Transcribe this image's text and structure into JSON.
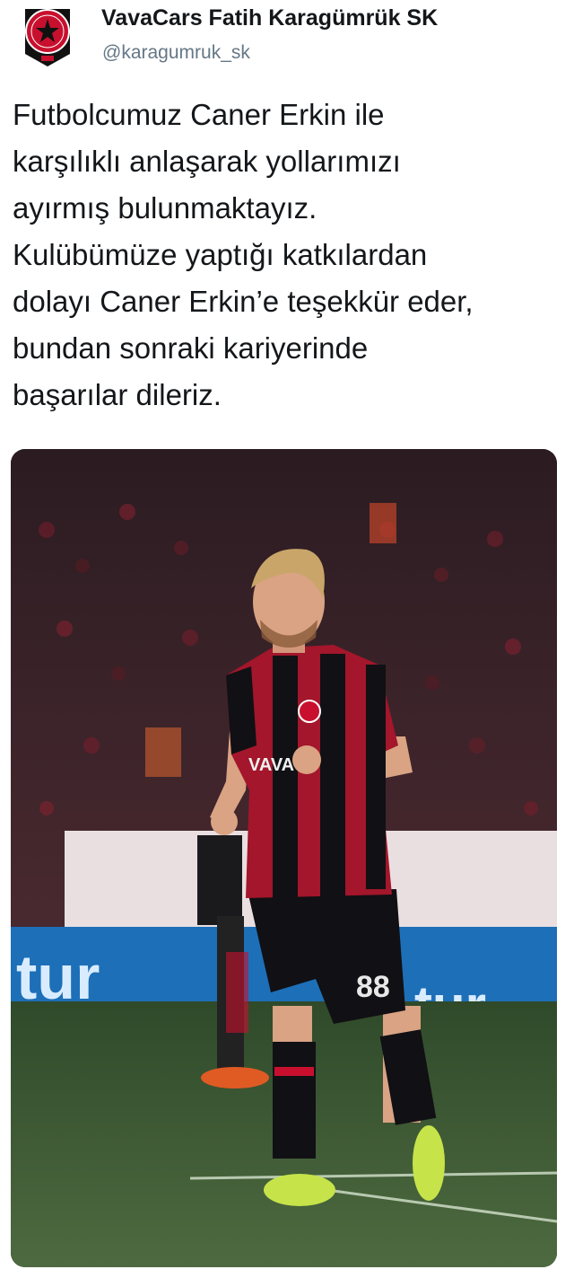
{
  "account": {
    "name": "VavaCars Fatih Karagümrük SK",
    "handle": "@karagumruk_sk",
    "avatar_icon": "club-crest-icon"
  },
  "tweet": {
    "lines": [
      "Futbolcumuz Caner Erkin ile",
      "karşılıklı anlaşarak yollarımızı",
      "ayırmış bulunmaktayız.",
      "Kulübümüze yaptığı katkılardan",
      "dolayı Caner Erkin’e teşekkür eder,",
      "bundan sonraki kariyerinde",
      "başarılar dileriz."
    ]
  },
  "media": {
    "jersey_number": "88",
    "sponsor_text": "VAVAC",
    "board_text_left": "tur",
    "board_text_right": "tur",
    "colors": {
      "jersey_red": "#a3162b",
      "jersey_black": "#111014",
      "pitch": "#3f5a35",
      "board_blue": "#1d6fb8",
      "boot_yellow": "#c6e34a"
    }
  }
}
